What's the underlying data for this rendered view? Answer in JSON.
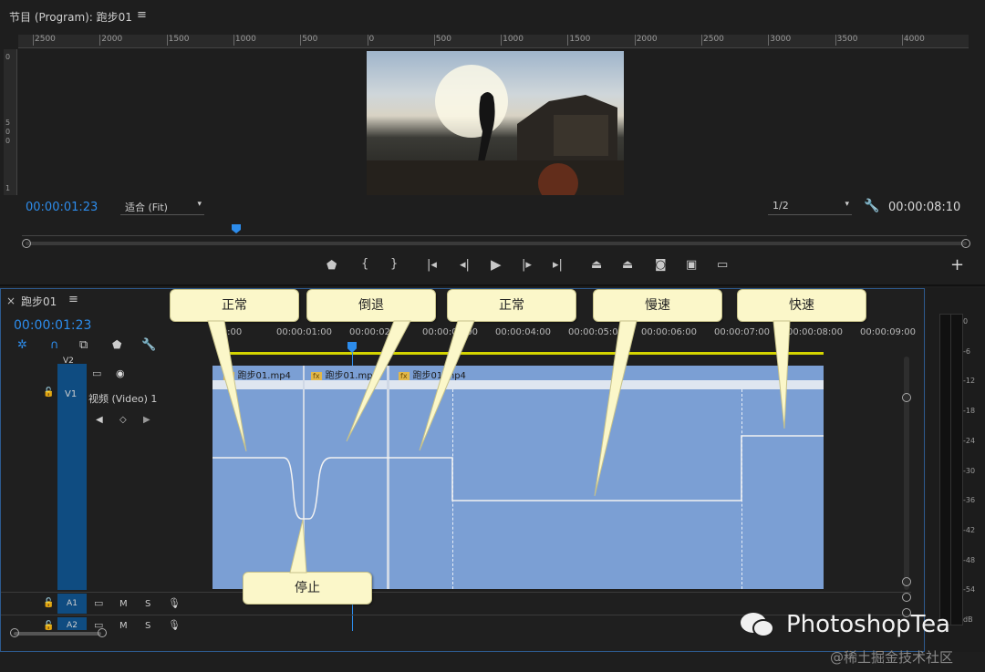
{
  "program": {
    "title": "节目 (Program): 跑步01",
    "menu_icon": "≡",
    "ruler_labels": [
      "2500",
      "2000",
      "1500",
      "1000",
      "500",
      "0",
      "500",
      "1000",
      "1500",
      "2000",
      "2500",
      "3000",
      "3500",
      "4000"
    ],
    "vertical_labels": [
      "0",
      "5",
      "0",
      "0",
      "1"
    ],
    "timecode": "00:00:01:23",
    "fit_label": "适合 (Fit)",
    "quality_label": "1/2",
    "duration": "00:00:08:10"
  },
  "transport": {
    "buttons": [
      "marker-icon",
      "in-point-icon",
      "out-point-icon",
      "go-to-in-icon",
      "step-back-icon",
      "play-icon",
      "step-forward-icon",
      "go-to-out-icon",
      "lift-icon",
      "extract-icon",
      "camera-icon",
      "compare-icon",
      "button-editor-icon"
    ],
    "add": "+"
  },
  "timeline": {
    "close": "×",
    "title": "跑步01",
    "menu_icon": "≡",
    "timecode": "00:00:01:23",
    "ruler_labels": [
      ":00:00",
      "00:00:01:00",
      "00:00:02:00",
      "00:00:03:00",
      "00:00:04:00",
      "00:00:05:00",
      "00:00:06:00",
      "00:00:07:00",
      "00:00:08:00",
      "00:00:09:00"
    ],
    "v2": "V2",
    "v1": "V1",
    "v1_name": "视频 (Video) 1",
    "a1": "A1",
    "a2": "A2",
    "m": "M",
    "s": "S",
    "clips": [
      "跑步01.mp4",
      "跑步01.mp4",
      "跑步01.mp4"
    ],
    "fx": "fx"
  },
  "meter": {
    "labels": [
      "0",
      "-6",
      "-12",
      "-18",
      "-24",
      "-30",
      "-36",
      "-42",
      "-48",
      "-54",
      "dB"
    ]
  },
  "callouts": {
    "normal1": "正常",
    "reverse": "倒退",
    "normal2": "正常",
    "slow": "慢速",
    "fast": "快速",
    "stop": "停止"
  },
  "watermark": {
    "brand": "PhotoshopTea",
    "sub": "@稀土掘金技术社区"
  },
  "colors": {
    "accent": "#2d8ceb",
    "clip": "#7b9fd4",
    "track_blue": "#0f4c81",
    "callout": "#fbf7c9",
    "work_area": "#d4d400"
  }
}
